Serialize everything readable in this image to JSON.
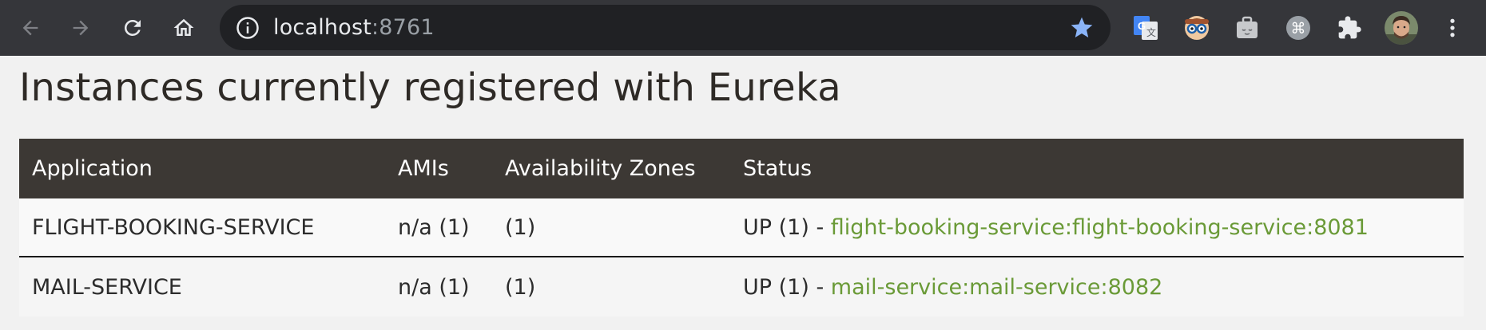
{
  "browser": {
    "url_host": "localhost",
    "url_port": ":8761",
    "icons": {
      "back": "arrow-left-icon",
      "forward": "arrow-right-icon",
      "reload": "reload-icon",
      "home": "home-icon",
      "info": "info-icon",
      "bookmark": "star-icon",
      "extensions": [
        "google-translate-icon",
        "nerd-glasses-icon",
        "briefcase-icon",
        "command-icon",
        "puzzle-icon"
      ],
      "profile": "avatar",
      "menu": "more-vert-icon"
    },
    "colors": {
      "toolbar": "#35363a",
      "omnibox": "#202124",
      "star": "#8ab4f8"
    }
  },
  "page": {
    "title": "Instances currently registered with Eureka",
    "table": {
      "headers": [
        "Application",
        "AMIs",
        "Availability Zones",
        "Status"
      ],
      "rows": [
        {
          "application": "FLIGHT-BOOKING-SERVICE",
          "amis": "n/a (1)",
          "zones": "(1)",
          "status_prefix": "UP (1) - ",
          "status_link": "flight-booking-service:flight-booking-service:8081"
        },
        {
          "application": "MAIL-SERVICE",
          "amis": "n/a (1)",
          "zones": "(1)",
          "status_prefix": "UP (1) - ",
          "status_link": "mail-service:mail-service:8082"
        }
      ]
    },
    "colors": {
      "header_bg": "#3c3834",
      "link": "#6a9a37",
      "background": "#f1f1f1"
    }
  }
}
